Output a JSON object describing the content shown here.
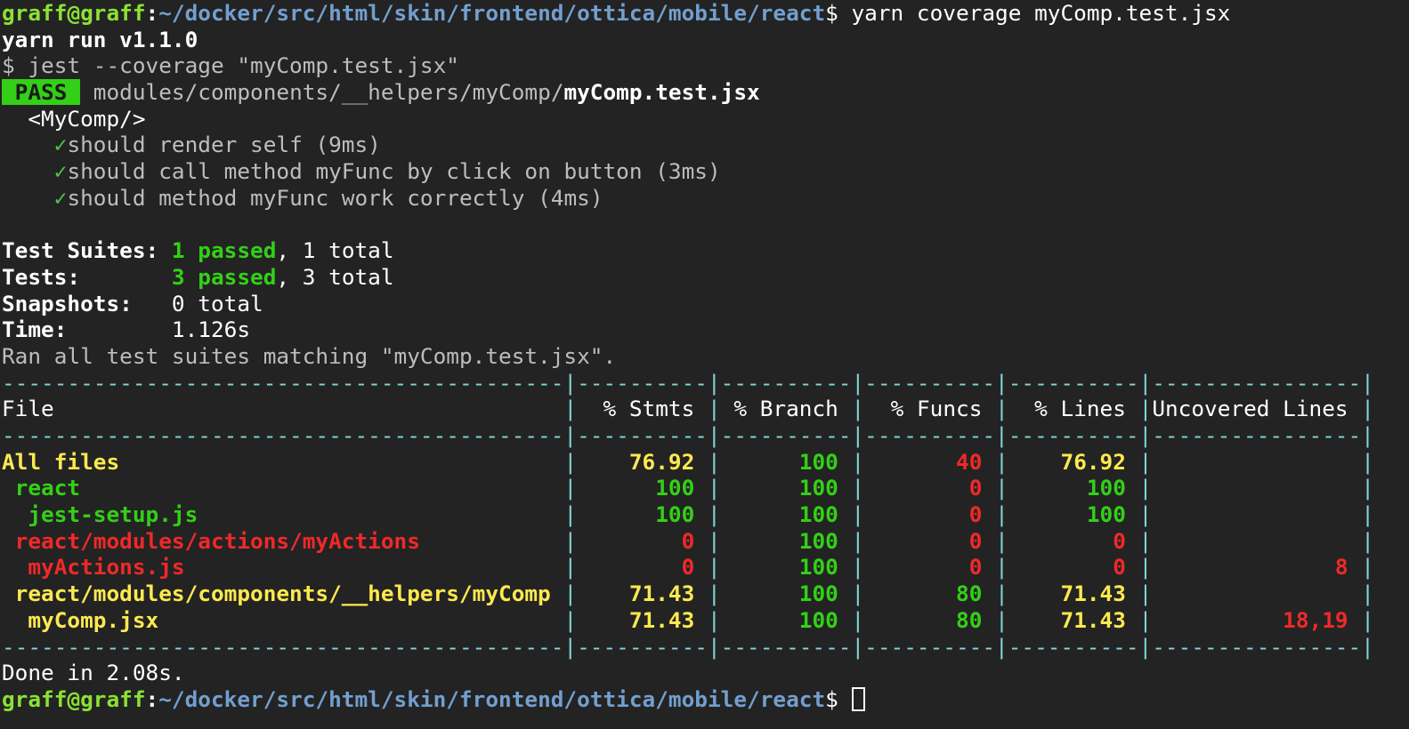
{
  "prompt": {
    "user": "graff@graff",
    "colon": ":",
    "path": "~/docker/src/html/skin/frontend/ottica/mobile/react",
    "sign": "$",
    "command": " yarn coverage myComp.test.jsx"
  },
  "yarn_header": "yarn run v1.1.0",
  "jest_command": "$ jest --coverage \"myComp.test.jsx\"",
  "pass_badge": " PASS ",
  "test_file_dir": "modules/components/__helpers/myComp/",
  "test_file_name": "myComp.test.jsx",
  "describe_block": "  <MyComp/>",
  "tests": [
    {
      "check": "✓",
      "name": "should render self (9ms)"
    },
    {
      "check": "✓",
      "name": "should call method myFunc by click on button (3ms)"
    },
    {
      "check": "✓",
      "name": "should method myFunc work correctly (4ms)"
    }
  ],
  "summary": {
    "suites_label": "Test Suites: ",
    "suites_passed": "1 passed",
    "suites_total": ", 1 total",
    "tests_label": "Tests:       ",
    "tests_passed": "3 passed",
    "tests_total": ", 3 total",
    "snapshots_label": "Snapshots:   ",
    "snapshots_value": "0 total",
    "time_label": "Time:        ",
    "time_value": "1.126s"
  },
  "ran_message": "Ran all test suites matching \"myComp.test.jsx\".",
  "coverage": {
    "separator": "-------------------------------------------|----------|----------|----------|----------|----------------|",
    "header": {
      "file": "File",
      "stmts": "% Stmts",
      "branch": "% Branch",
      "funcs": "% Funcs",
      "lines": "% Lines",
      "uncovered": "Uncovered Lines"
    },
    "rows": [
      {
        "file": "All files",
        "indent": 0,
        "stmts": "76.92",
        "branch": "100",
        "funcs": "40",
        "lines": "76.92",
        "uncovered": "",
        "c_file": "yellow",
        "c_stmts": "yellow",
        "c_branch": "green",
        "c_funcs": "red",
        "c_lines": "yellow",
        "c_unc": "red"
      },
      {
        "file": "react",
        "indent": 1,
        "stmts": "100",
        "branch": "100",
        "funcs": "0",
        "lines": "100",
        "uncovered": "",
        "c_file": "green",
        "c_stmts": "green",
        "c_branch": "green",
        "c_funcs": "red",
        "c_lines": "green",
        "c_unc": "red"
      },
      {
        "file": "jest-setup.js",
        "indent": 2,
        "stmts": "100",
        "branch": "100",
        "funcs": "0",
        "lines": "100",
        "uncovered": "",
        "c_file": "green",
        "c_stmts": "green",
        "c_branch": "green",
        "c_funcs": "red",
        "c_lines": "green",
        "c_unc": "red"
      },
      {
        "file": "react/modules/actions/myActions",
        "indent": 1,
        "stmts": "0",
        "branch": "100",
        "funcs": "0",
        "lines": "0",
        "uncovered": "",
        "c_file": "red",
        "c_stmts": "red",
        "c_branch": "green",
        "c_funcs": "red",
        "c_lines": "red",
        "c_unc": "red"
      },
      {
        "file": "myActions.js",
        "indent": 2,
        "stmts": "0",
        "branch": "100",
        "funcs": "0",
        "lines": "0",
        "uncovered": "8",
        "c_file": "red",
        "c_stmts": "red",
        "c_branch": "green",
        "c_funcs": "red",
        "c_lines": "red",
        "c_unc": "red"
      },
      {
        "file": "react/modules/components/__helpers/myComp",
        "indent": 1,
        "stmts": "71.43",
        "branch": "100",
        "funcs": "80",
        "lines": "71.43",
        "uncovered": "",
        "c_file": "yellow",
        "c_stmts": "yellow",
        "c_branch": "green",
        "c_funcs": "green",
        "c_lines": "yellow",
        "c_unc": "red"
      },
      {
        "file": "myComp.jsx",
        "indent": 2,
        "stmts": "71.43",
        "branch": "100",
        "funcs": "80",
        "lines": "71.43",
        "uncovered": "18,19",
        "c_file": "yellow",
        "c_stmts": "yellow",
        "c_branch": "green",
        "c_funcs": "green",
        "c_lines": "yellow",
        "c_unc": "red"
      }
    ]
  },
  "done_message": "Done in 2.08s.",
  "colors": {
    "background": "#232323",
    "prompt_user": "#8ae234",
    "prompt_path": "#729fcf",
    "pass": "#33d017",
    "yellow": "#fce94f",
    "red": "#ef2929",
    "separator": "#7fd6d6"
  }
}
